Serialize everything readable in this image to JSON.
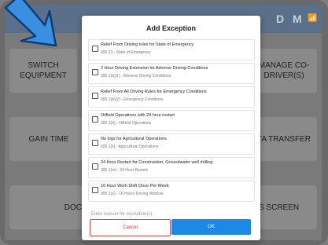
{
  "appbar": {
    "back_icon": "←",
    "icons": [
      "D",
      "M"
    ],
    "signal_icon": "📶"
  },
  "background_tiles": [
    {
      "label": "SWITCH\nEQUIPMENT"
    },
    {
      "label": "MANAGE CO-\nDRIVER(S)"
    },
    {
      "label": "GAIN TIME"
    },
    {
      "label": "TA TRANSFER"
    },
    {
      "label": "DOC"
    },
    {
      "label": "S SCREEN"
    }
  ],
  "dialog": {
    "title": "Add Exception",
    "options": [
      {
        "title": "Relief From Driving rules for State of Emergency",
        "sub": "395.23  -  State of Emergency"
      },
      {
        "title": "2 Hour Driving Extension for Adverse Driving Conditions",
        "sub": "395.1(b)(1)  -  Adverse Driving Conditions"
      },
      {
        "title": "Relief From All Driving Rules for Emergency Conditions",
        "sub": "395.1(b)(2)  -  Emergency Conditions"
      },
      {
        "title": "Oilfield Operations with 24 hour restart",
        "sub": "395.1(d)  -  Oilfield Operations"
      },
      {
        "title": "No logs for Agricultural Operations",
        "sub": "395.1(k)  -  Agricultural Operations"
      },
      {
        "title": "24 Hour Restart for Construction, Groundwater well drilling",
        "sub": "395.1(m)  -  24 Hour Restart"
      },
      {
        "title": "16 Hour Work Shift Once Per Week",
        "sub": "395.1(o)  -  16 Hours Driving Window"
      }
    ],
    "reason_placeholder": "Enter reason for exception(s)",
    "cancel_label": "Cancel",
    "ok_label": "OK"
  }
}
